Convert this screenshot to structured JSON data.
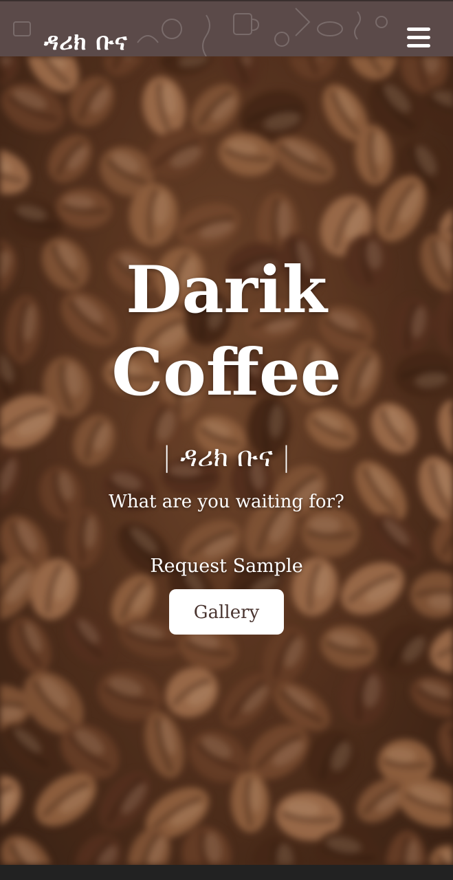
{
  "header": {
    "brand": "ዳሪክ ቡና",
    "menu_icon": "hamburger-icon"
  },
  "hero": {
    "title_line1": "Darik",
    "title_line2": "Coffee",
    "subtitle": "| ዳሪክ ቡና |",
    "tagline": "What are you waiting for?",
    "request_link": "Request Sample",
    "gallery_button": "Gallery"
  },
  "colors": {
    "header_bg": "#5b4a49",
    "button_bg": "#ffffff",
    "button_text": "#4a3530"
  }
}
